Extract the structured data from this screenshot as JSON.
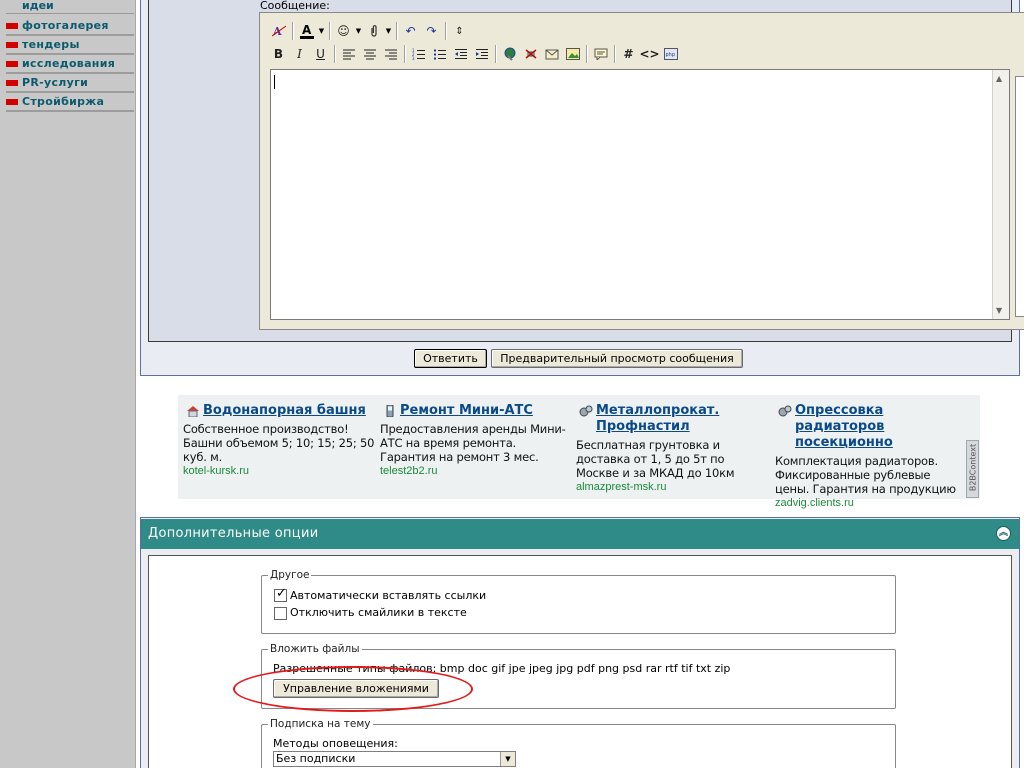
{
  "sidebar": {
    "top_item": "идеи",
    "items": [
      {
        "label": "фотогалерея"
      },
      {
        "label": "тендеры"
      },
      {
        "label": "исследования"
      },
      {
        "label": "PR-услуги"
      },
      {
        "label": "Стройбиржа"
      }
    ]
  },
  "reply": {
    "message_label": "Сообщение:",
    "message_value": "",
    "submit_label": "Ответить",
    "preview_label": "Предварительный просмотр сообщения"
  },
  "ads": [
    {
      "title": "Водонапорная башня",
      "text": "Собственное производство! Башни объемом 5; 10; 15; 25; 50 куб. м.",
      "url": "kotel-kursk.ru",
      "icon": "house-icon"
    },
    {
      "title": "Ремонт Мини-АТС",
      "text": "Предоставления аренды Мини-АТС на время ремонта. Гарантия на ремонт 3 мес.",
      "url": "telest2b2.ru",
      "icon": "phone-icon"
    },
    {
      "title": "Металлопрокат. Профнастил",
      "text": "Бесплатная грунтовка и доставка от 1, 5 до 5т по Москве и за МКАД до 10км",
      "url": "almazprest-msk.ru",
      "icon": "gears-icon"
    },
    {
      "title": "Опрессовка радиаторов посекционно",
      "text": "Комплектация радиаторов. Фиксированные рублевые цены. Гарантия на продукцию",
      "url": "zadvig.clients.ru",
      "icon": "gears-icon"
    }
  ],
  "ads_badge": "B2BContext",
  "options": {
    "title": "Дополнительные опции",
    "other": {
      "legend": "Другое",
      "auto_links": "Автоматически вставлять ссылки",
      "auto_links_checked": true,
      "disable_smilies": "Отключить смайлики в тексте",
      "disable_smilies_checked": false
    },
    "attach": {
      "legend": "Вложить файлы",
      "allowed": "Разрешенные типы файлов: bmp doc gif jpe jpeg jpg pdf png psd rar rtf tif txt zip",
      "manage_button": "Управление вложениями"
    },
    "subscribe": {
      "legend": "Подписка на тему",
      "methods_label": "Методы оповещения:",
      "selected": "Без подписки"
    }
  },
  "colors": {
    "accent_teal": "#2e8b87",
    "link_blue": "#0b4a8a",
    "ad_url_green": "#1a8a3a",
    "sidebar_marker": "#d40000",
    "annotation_red": "#e41a1a"
  }
}
